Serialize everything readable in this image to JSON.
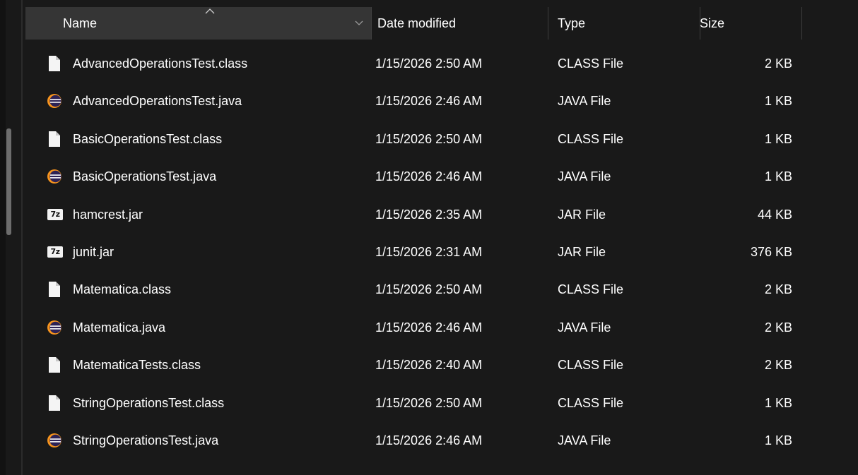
{
  "columns": {
    "name": "Name",
    "date": "Date modified",
    "type": "Type",
    "size": "Size"
  },
  "files": [
    {
      "name": "AdvancedOperationsTest.class",
      "date": "1/15/2026 2:50 AM",
      "type": "CLASS File",
      "size": "2 KB",
      "icon": "document-icon"
    },
    {
      "name": "AdvancedOperationsTest.java",
      "date": "1/15/2026 2:46 AM",
      "type": "JAVA File",
      "size": "1 KB",
      "icon": "eclipse-icon"
    },
    {
      "name": "BasicOperationsTest.class",
      "date": "1/15/2026 2:50 AM",
      "type": "CLASS File",
      "size": "1 KB",
      "icon": "document-icon"
    },
    {
      "name": "BasicOperationsTest.java",
      "date": "1/15/2026 2:46 AM",
      "type": "JAVA File",
      "size": "1 KB",
      "icon": "eclipse-icon"
    },
    {
      "name": "hamcrest.jar",
      "date": "1/15/2026 2:35 AM",
      "type": "JAR File",
      "size": "44 KB",
      "icon": "7zip-icon"
    },
    {
      "name": "junit.jar",
      "date": "1/15/2026 2:31 AM",
      "type": "JAR File",
      "size": "376 KB",
      "icon": "7zip-icon"
    },
    {
      "name": "Matematica.class",
      "date": "1/15/2026 2:50 AM",
      "type": "CLASS File",
      "size": "2 KB",
      "icon": "document-icon"
    },
    {
      "name": "Matematica.java",
      "date": "1/15/2026 2:46 AM",
      "type": "JAVA File",
      "size": "2 KB",
      "icon": "eclipse-icon"
    },
    {
      "name": "MatematicaTests.class",
      "date": "1/15/2026 2:40 AM",
      "type": "CLASS File",
      "size": "2 KB",
      "icon": "document-icon"
    },
    {
      "name": "StringOperationsTest.class",
      "date": "1/15/2026 2:50 AM",
      "type": "CLASS File",
      "size": "1 KB",
      "icon": "document-icon"
    },
    {
      "name": "StringOperationsTest.java",
      "date": "1/15/2026 2:46 AM",
      "type": "JAVA File",
      "size": "1 KB",
      "icon": "eclipse-icon"
    }
  ],
  "badge_7z": "7z",
  "colors": {
    "background": "#191919",
    "header_selected": "#353535",
    "eclipse_orange": "#f7941e",
    "eclipse_purple": "#2c2255"
  }
}
